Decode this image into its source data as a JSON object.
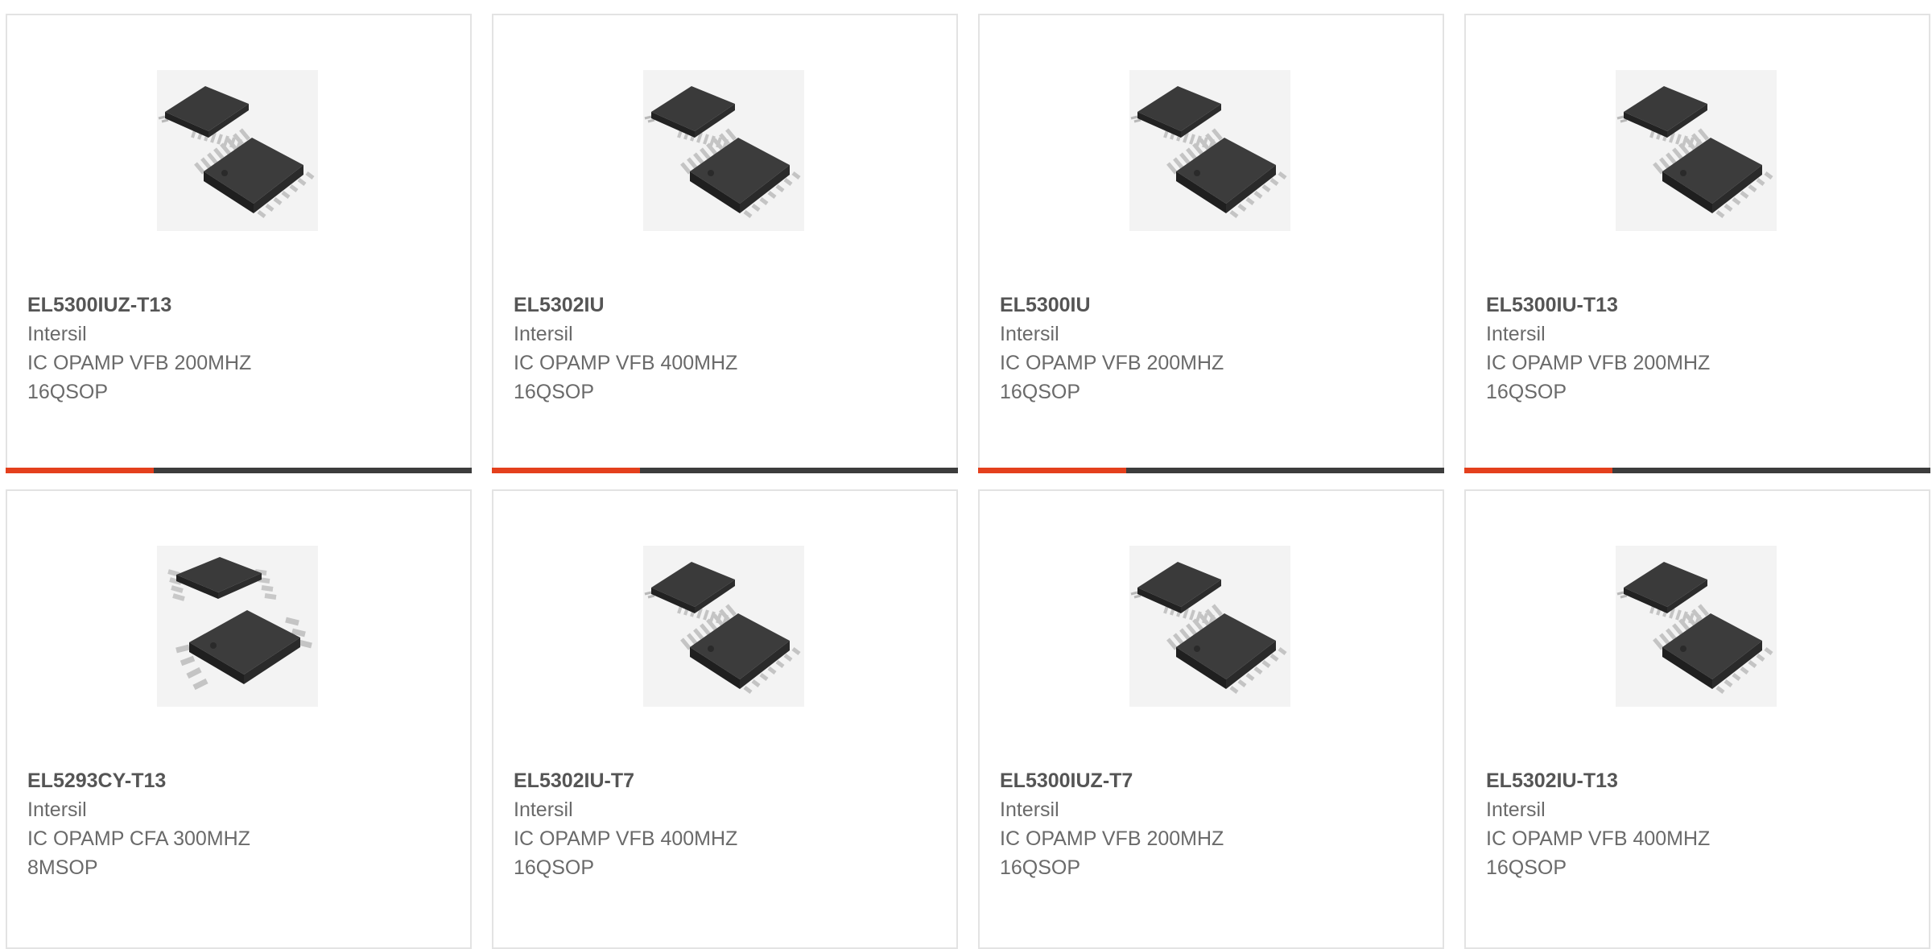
{
  "colors": {
    "accent": "#e4401d",
    "bar": "#3d3d3d",
    "border": "#e3e3e3"
  },
  "products": [
    {
      "part": "EL5300IUZ-T13",
      "manufacturer": "Intersil",
      "description": "IC OPAMP VFB 200MHZ 16QSOP",
      "package_icon": "qsop16-chip-image"
    },
    {
      "part": "EL5302IU",
      "manufacturer": "Intersil",
      "description": "IC OPAMP VFB 400MHZ 16QSOP",
      "package_icon": "qsop16-chip-image"
    },
    {
      "part": "EL5300IU",
      "manufacturer": "Intersil",
      "description": "IC OPAMP VFB 200MHZ 16QSOP",
      "package_icon": "qsop16-chip-image"
    },
    {
      "part": "EL5300IU-T13",
      "manufacturer": "Intersil",
      "description": "IC OPAMP VFB 200MHZ 16QSOP",
      "package_icon": "qsop16-chip-image"
    },
    {
      "part": "EL5293CY-T13",
      "manufacturer": "Intersil",
      "description": "IC OPAMP CFA 300MHZ 8MSOP",
      "package_icon": "msop8-chip-image"
    },
    {
      "part": "EL5302IU-T7",
      "manufacturer": "Intersil",
      "description": "IC OPAMP VFB 400MHZ 16QSOP",
      "package_icon": "qsop16-chip-image"
    },
    {
      "part": "EL5300IUZ-T7",
      "manufacturer": "Intersil",
      "description": "IC OPAMP VFB 200MHZ 16QSOP",
      "package_icon": "qsop16-chip-image"
    },
    {
      "part": "EL5302IU-T13",
      "manufacturer": "Intersil",
      "description": "IC OPAMP VFB 400MHZ 16QSOP",
      "package_icon": "qsop16-chip-image"
    }
  ]
}
